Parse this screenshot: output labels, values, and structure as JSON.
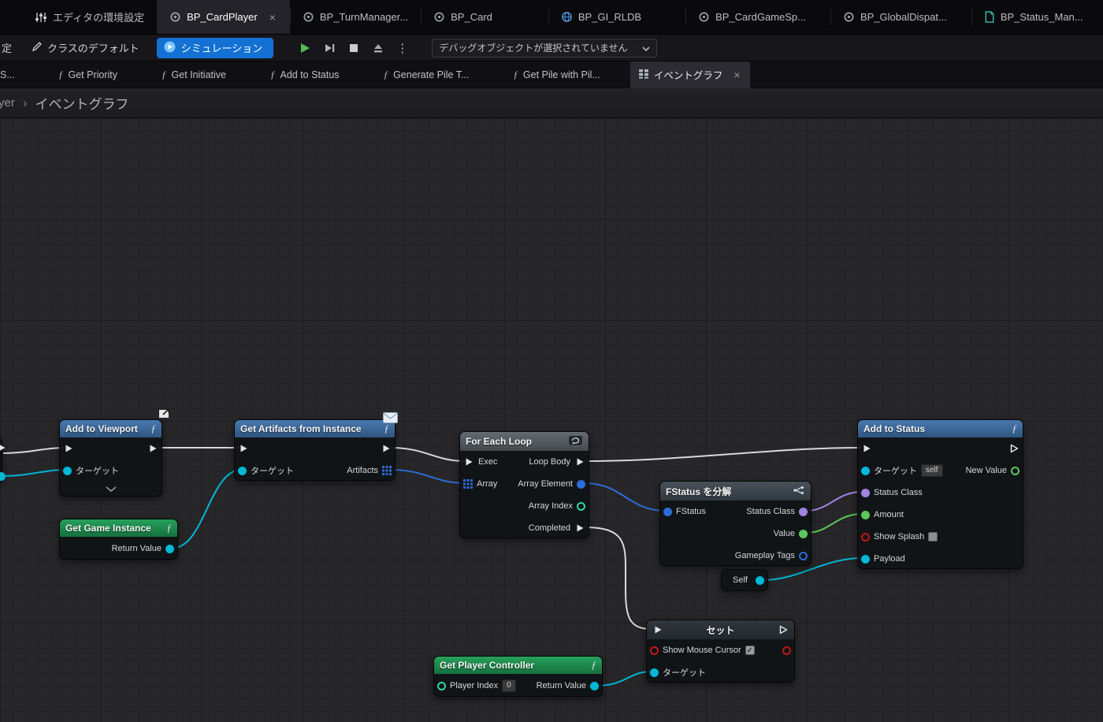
{
  "icons_glyphs": {
    "close": "×",
    "function_symbol": "ƒ",
    "kebab": "⋮",
    "check": "✓",
    "breadcrumb_sep": "›"
  },
  "colors": {
    "accent_blue": "#1271d3",
    "node_header_blue": "#3a6fa8",
    "node_header_green": "#1f9150",
    "pin_exec": "#e3e3e3",
    "pin_object": "#00b7d6",
    "pin_struct": "#2e6cd6",
    "pin_class": "#a183e0",
    "pin_float": "#5ac85a",
    "pin_int": "#2fd6a4",
    "pin_bool": "#c11515"
  },
  "tab_bar": {
    "tabs": [
      {
        "label": "エディタの環境設定",
        "icon": "sliders-icon",
        "active": false
      },
      {
        "label": "BP_CardPlayer",
        "icon": "blueprint-icon",
        "active": true,
        "closable": true
      },
      {
        "label": "BP_TurnManager...",
        "icon": "blueprint-icon",
        "active": false
      },
      {
        "label": "BP_Card",
        "icon": "blueprint-icon",
        "active": false
      },
      {
        "label": "BP_GI_RLDB",
        "icon": "globe-icon",
        "active": false
      },
      {
        "label": "BP_CardGameSp...",
        "icon": "blueprint-icon",
        "active": false
      },
      {
        "label": "BP_GlobalDispat...",
        "icon": "blueprint-icon",
        "active": false
      },
      {
        "label": "BP_Status_Man...",
        "icon": "document-icon",
        "active": false
      }
    ]
  },
  "toolbar": {
    "partial_left": "定",
    "class_defaults_label": "クラスのデフォルト",
    "simulate_label": "シミュレーション",
    "debug_placeholder": "デバッグオブジェクトが選択されていません"
  },
  "graph_tabs": {
    "partial_left": "S...",
    "items": [
      {
        "label": "Get Priority"
      },
      {
        "label": "Get Initiative"
      },
      {
        "label": "Add to Status"
      },
      {
        "label": "Generate Pile T..."
      },
      {
        "label": "Get Pile with Pil..."
      },
      {
        "label": "イベントグラフ",
        "active": true,
        "closable": true
      }
    ]
  },
  "breadcrumb": {
    "parent": "yer",
    "current": "イベントグラフ"
  },
  "nodes": {
    "add_to_viewport": {
      "title": "Add to Viewport",
      "target_label": "ターゲット"
    },
    "get_game_instance": {
      "title": "Get Game Instance",
      "return_label": "Return Value"
    },
    "get_artifacts_from_instance": {
      "title": "Get Artifacts from Instance",
      "target_label": "ターゲット",
      "artifacts_label": "Artifacts"
    },
    "for_each_loop": {
      "title": "For Each Loop",
      "exec_label": "Exec",
      "array_label": "Array",
      "loop_body_label": "Loop Body",
      "array_element_label": "Array Element",
      "array_index_label": "Array Index",
      "completed_label": "Completed"
    },
    "break_fstatus": {
      "title": "FStatus を分解",
      "input_label": "FStatus",
      "status_class_label": "Status Class",
      "value_label": "Value",
      "gameplay_tags_label": "Gameplay Tags"
    },
    "self_node": {
      "title": "Self"
    },
    "add_to_status": {
      "title": "Add to Status",
      "target_label": "ターゲット",
      "target_value": "self",
      "new_value_label": "New Value",
      "status_class_label": "Status Class",
      "amount_label": "Amount",
      "show_splash_label": "Show Splash",
      "show_splash_checked": false,
      "payload_label": "Payload"
    },
    "set_show_mouse_cursor": {
      "title": "セット",
      "var_label": "Show Mouse Cursor",
      "checked": true,
      "target_label": "ターゲット"
    },
    "get_player_controller": {
      "title": "Get Player Controller",
      "player_index_label": "Player Index",
      "player_index_value": "0",
      "return_label": "Return Value"
    }
  }
}
